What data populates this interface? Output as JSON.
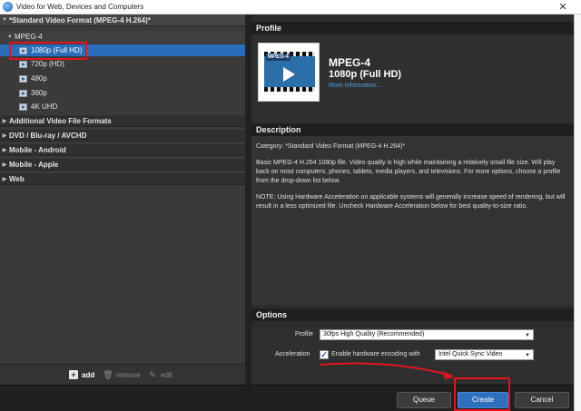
{
  "window": {
    "title": "Video for Web, Devices and Computers",
    "close_glyph": "✕"
  },
  "tree": {
    "categories": [
      {
        "label": "*Standard Video Format (MPEG-4 H.264)*",
        "expanded": true
      },
      {
        "label": "Additional Video File Formats"
      },
      {
        "label": "DVD / Blu-ray / AVCHD"
      },
      {
        "label": "Mobile - Android"
      },
      {
        "label": "Mobile - Apple"
      },
      {
        "label": "Web"
      }
    ],
    "group_label": "MPEG-4",
    "items": [
      "1080p (Full HD)",
      "720p (HD)",
      "480p",
      "360p",
      "4K UHD"
    ],
    "selected_index": 0,
    "arrow_expanded": "▼",
    "arrow_collapsed": "▶"
  },
  "left_toolbar": {
    "add": "add",
    "remove": "remove",
    "edit": "edit",
    "icons": {
      "add": "plus-square-icon",
      "remove": "trash-icon",
      "edit": "pencil-icon"
    },
    "add_glyph": "+",
    "remove_glyph": "🗑",
    "edit_glyph": "✎"
  },
  "profile": {
    "heading": "Profile",
    "format": "MPEG-4",
    "resolution": "1080p (Full HD)",
    "more_link": "More information...",
    "thumb_tag": "MPEG-4"
  },
  "description": {
    "heading": "Description",
    "category_line": "Category: *Standard Video Format (MPEG-4 H.264)*",
    "paragraph1": "Basic MPEG-4 H.264 1080p file. Video quality is high while maintaining a relatively small file size. Will play back on most computers, phones, tablets, media players, and televisions. For more options, choose a profile from the drop-down list below.",
    "paragraph2": "NOTE: Using Hardware Acceleration on applicable systems will generally increase speed of rendering, but will result in a less optimized file. Uncheck Hardware Acceleration below for best quality-to-size ratio."
  },
  "options": {
    "heading": "Options",
    "profile_label": "Profile",
    "profile_value": "30fps High Quality (Recommended)",
    "acceleration_label": "Acceleration",
    "hw_checkbox_checked": true,
    "hw_checkbox_glyph": "✓",
    "hw_label": "Enable hardware encoding with",
    "hw_value": "Intel Quick Sync Video",
    "caret_glyph": "▼"
  },
  "buttons": {
    "queue": "Queue",
    "create": "Create",
    "cancel": "Cancel"
  },
  "colors": {
    "selection": "#2a6ebb",
    "primary_button": "#2f6fc0",
    "annotation": "#e3141e",
    "link": "#4c9fe8"
  }
}
